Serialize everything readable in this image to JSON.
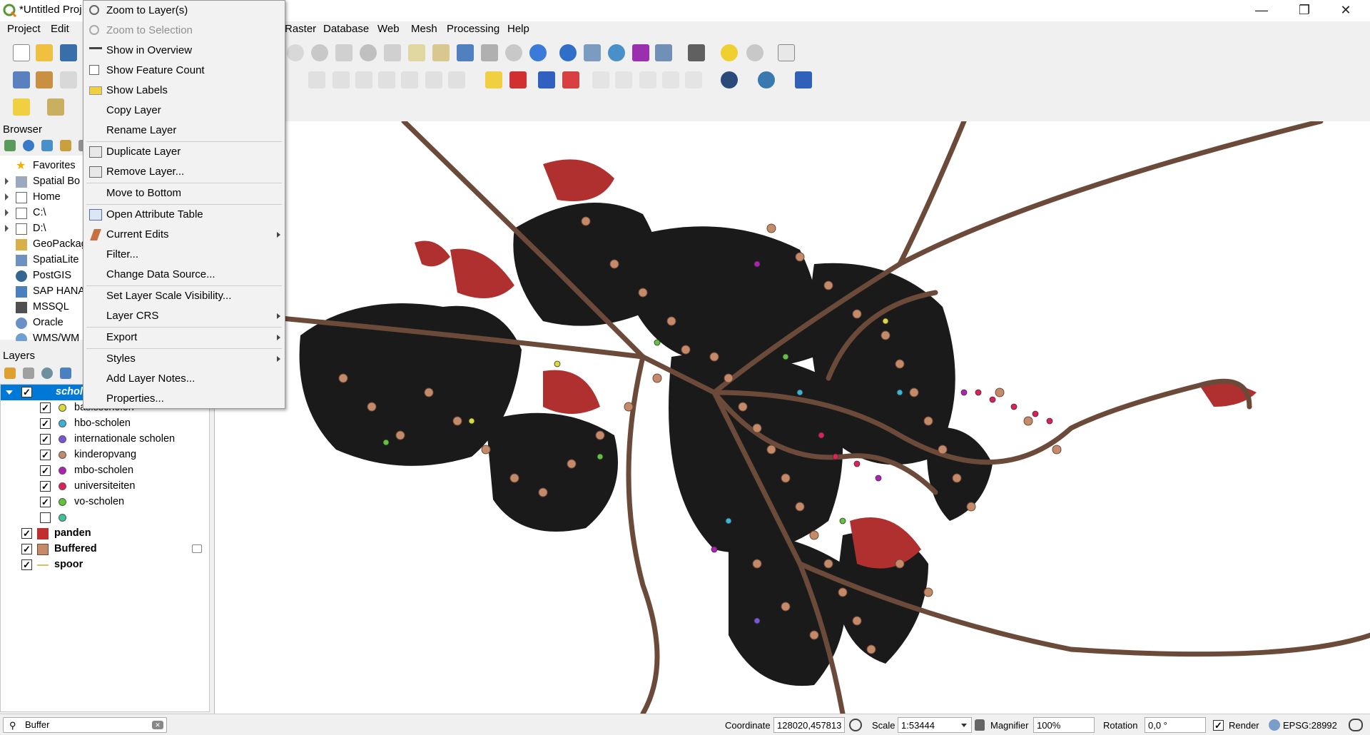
{
  "window": {
    "title": "*Untitled Proj",
    "minimize": "—",
    "restore": "❐",
    "close": "✕"
  },
  "menubar": {
    "project": "Project",
    "edit": "Edit",
    "raster": "Raster",
    "database": "Database",
    "web": "Web",
    "mesh": "Mesh",
    "processing": "Processing",
    "help": "Help"
  },
  "browser": {
    "header": "Browser",
    "items": [
      {
        "label": "Favorites",
        "icon": "star-icon"
      },
      {
        "label": "Spatial Bo",
        "icon": "bookmark-icon"
      },
      {
        "label": "Home",
        "icon": "home-folder-icon"
      },
      {
        "label": "C:\\",
        "icon": "drive-icon"
      },
      {
        "label": "D:\\",
        "icon": "drive-icon"
      },
      {
        "label": "GeoPackag",
        "icon": "geopackage-icon"
      },
      {
        "label": "SpatiaLite",
        "icon": "spatialite-icon"
      },
      {
        "label": "PostGIS",
        "icon": "postgis-icon"
      },
      {
        "label": "SAP HANA",
        "icon": "sap-hana-icon"
      },
      {
        "label": "MSSQL",
        "icon": "mssql-icon"
      },
      {
        "label": "Oracle",
        "icon": "oracle-icon"
      },
      {
        "label": "WMS/WM",
        "icon": "wms-icon"
      }
    ]
  },
  "layers": {
    "header": "Layers",
    "selected_group": "schol",
    "sublayers": [
      {
        "label": "basisscholen",
        "color": "#d9d93b"
      },
      {
        "label": "hbo-scholen",
        "color": "#3bb3d9"
      },
      {
        "label": "internationale scholen",
        "color": "#7a55d9"
      },
      {
        "label": "kinderopvang",
        "color": "#c48a6a"
      },
      {
        "label": "mbo-scholen",
        "color": "#b020b8"
      },
      {
        "label": "universiteiten",
        "color": "#e0205a"
      },
      {
        "label": "vo-scholen",
        "color": "#5fc43b"
      },
      {
        "label": "",
        "color": "#3bc49a"
      }
    ],
    "top_layers": [
      {
        "label": "panden"
      },
      {
        "label": "Buffered"
      },
      {
        "label": "spoor"
      }
    ]
  },
  "context_menu": {
    "zoom_to_layer": "Zoom to Layer(s)",
    "zoom_to_selection": "Zoom to Selection",
    "show_in_overview": "Show in Overview",
    "show_feature_count": "Show Feature Count",
    "show_labels": "Show Labels",
    "copy_layer": "Copy Layer",
    "rename_layer": "Rename Layer",
    "duplicate_layer": "Duplicate Layer",
    "remove_layer": "Remove Layer...",
    "move_to_bottom": "Move to Bottom",
    "open_attribute_table": "Open Attribute Table",
    "current_edits": "Current Edits",
    "filter": "Filter...",
    "change_data_source": "Change Data Source...",
    "set_scale_visibility": "Set Layer Scale Visibility...",
    "layer_crs": "Layer CRS",
    "export": "Export",
    "styles": "Styles",
    "add_layer_notes": "Add Layer Notes...",
    "properties": "Properties..."
  },
  "search": {
    "value": "Buffer"
  },
  "statusbar": {
    "coordinate_label": "Coordinate",
    "coordinate_value": "128020,457813",
    "scale_label": "Scale",
    "scale_value": "1:53444",
    "magnifier_label": "Magnifier",
    "magnifier_value": "100%",
    "rotation_label": "Rotation",
    "rotation_value": "0,0 °",
    "render_label": "Render",
    "crs": "EPSG:28992"
  },
  "colors": {
    "selection": "#0078d7",
    "buildings": "#1a1a1a",
    "buffered": "#c48a6a",
    "roads": "#6b4a3a",
    "panden_red": "#b03030"
  }
}
